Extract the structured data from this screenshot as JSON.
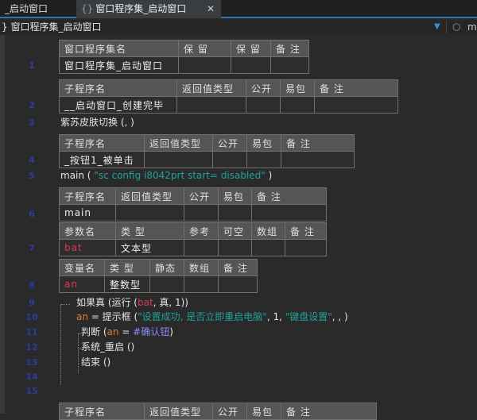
{
  "tabs": [
    {
      "label": "_启动窗口"
    },
    {
      "icon": "{}",
      "label": "窗口程序集_启动窗口",
      "close": "✕"
    }
  ],
  "breadcrumb": {
    "icon": "}",
    "label": "窗口程序集_启动窗口",
    "dropdown": "▼",
    "right_label": "m"
  },
  "line_numbers": [
    "1",
    "2",
    "3",
    "4",
    "5",
    "6",
    "7",
    "8",
    "9",
    "10",
    "11",
    "12",
    "13",
    "14",
    "15"
  ],
  "tables": [
    {
      "rows": [
        {
          "h": true,
          "cells": [
            "窗口程序集名",
            "保 留",
            "保 留",
            "备 注"
          ]
        },
        {
          "cells": [
            "窗口程序集_启动窗口",
            "",
            "",
            ""
          ]
        }
      ]
    },
    {
      "rows": [
        {
          "h": true,
          "cells": [
            "子程序名",
            "返回值类型",
            "公开",
            "易包",
            "备 注"
          ]
        },
        {
          "cells": [
            "__启动窗口_创建完毕",
            "",
            "",
            "",
            ""
          ]
        }
      ]
    },
    {
      "rows": [
        {
          "h": true,
          "cells": [
            "子程序名",
            "返回值类型",
            "公开",
            "易包",
            "备 注"
          ]
        },
        {
          "cells": [
            "_按钮1_被单击",
            "",
            "",
            "",
            ""
          ]
        }
      ]
    },
    {
      "rows": [
        {
          "h": true,
          "cells": [
            "子程序名",
            "返回值类型",
            "公开",
            "易包",
            "备 注"
          ]
        },
        {
          "cells": [
            "main",
            "",
            "",
            "",
            ""
          ]
        }
      ]
    },
    {
      "rows": [
        {
          "h": true,
          "cells": [
            "参数名",
            "类 型",
            "参考",
            "可空",
            "数组",
            "备 注"
          ]
        },
        {
          "cells": [
            "bat",
            "文本型",
            "",
            "",
            "",
            ""
          ]
        }
      ]
    },
    {
      "rows": [
        {
          "h": true,
          "cells": [
            "变量名",
            "类 型",
            "静态",
            "数组",
            "备 注"
          ]
        },
        {
          "cells": [
            "an",
            "整数型",
            "",
            "",
            ""
          ]
        }
      ]
    },
    {
      "rows": [
        {
          "h": true,
          "cells": [
            "子程序名",
            "返回值类型",
            "公开",
            "易包",
            "备 注"
          ]
        }
      ]
    }
  ],
  "code_lines": [
    [
      {
        "t": "紫苏皮肤切换 (, )",
        "c": "plain"
      }
    ],
    [
      {
        "t": "main ( ",
        "c": "plain"
      },
      {
        "t": "\"sc config i8042prt start= disabled\"",
        "c": "str"
      },
      {
        "t": " )",
        "c": "plain"
      }
    ],
    [
      {
        "t": "如果真 (运行 (",
        "c": "plain"
      },
      {
        "t": "bat",
        "c": "param"
      },
      {
        "t": ", 真, 1))",
        "c": "plain"
      }
    ],
    [
      {
        "t": "an",
        "c": "var"
      },
      {
        "t": " = 提示框 (",
        "c": "plain"
      },
      {
        "t": "\"设置成功, 是否立即重启电脑\"",
        "c": "str"
      },
      {
        "t": ", 1, ",
        "c": "plain"
      },
      {
        "t": "\"键盘设置\"",
        "c": "str"
      },
      {
        "t": ", , )",
        "c": "plain"
      }
    ],
    [
      {
        "t": "判断 (",
        "c": "plain"
      },
      {
        "t": "an",
        "c": "var"
      },
      {
        "t": " = ",
        "c": "plain"
      },
      {
        "t": "#确认钮",
        "c": "const"
      },
      {
        "t": ")",
        "c": "plain"
      }
    ],
    [
      {
        "t": "系统_重启 ()",
        "c": "plain"
      }
    ],
    [
      {
        "t": "结束 ()",
        "c": "plain"
      }
    ]
  ],
  "colors": {
    "accent": "#2f74b0",
    "line_number": "#2e3a9e",
    "string": "#1fa39a",
    "variable": "#e07a2a",
    "parameter": "#d9365a",
    "constant": "#8c8cff"
  }
}
